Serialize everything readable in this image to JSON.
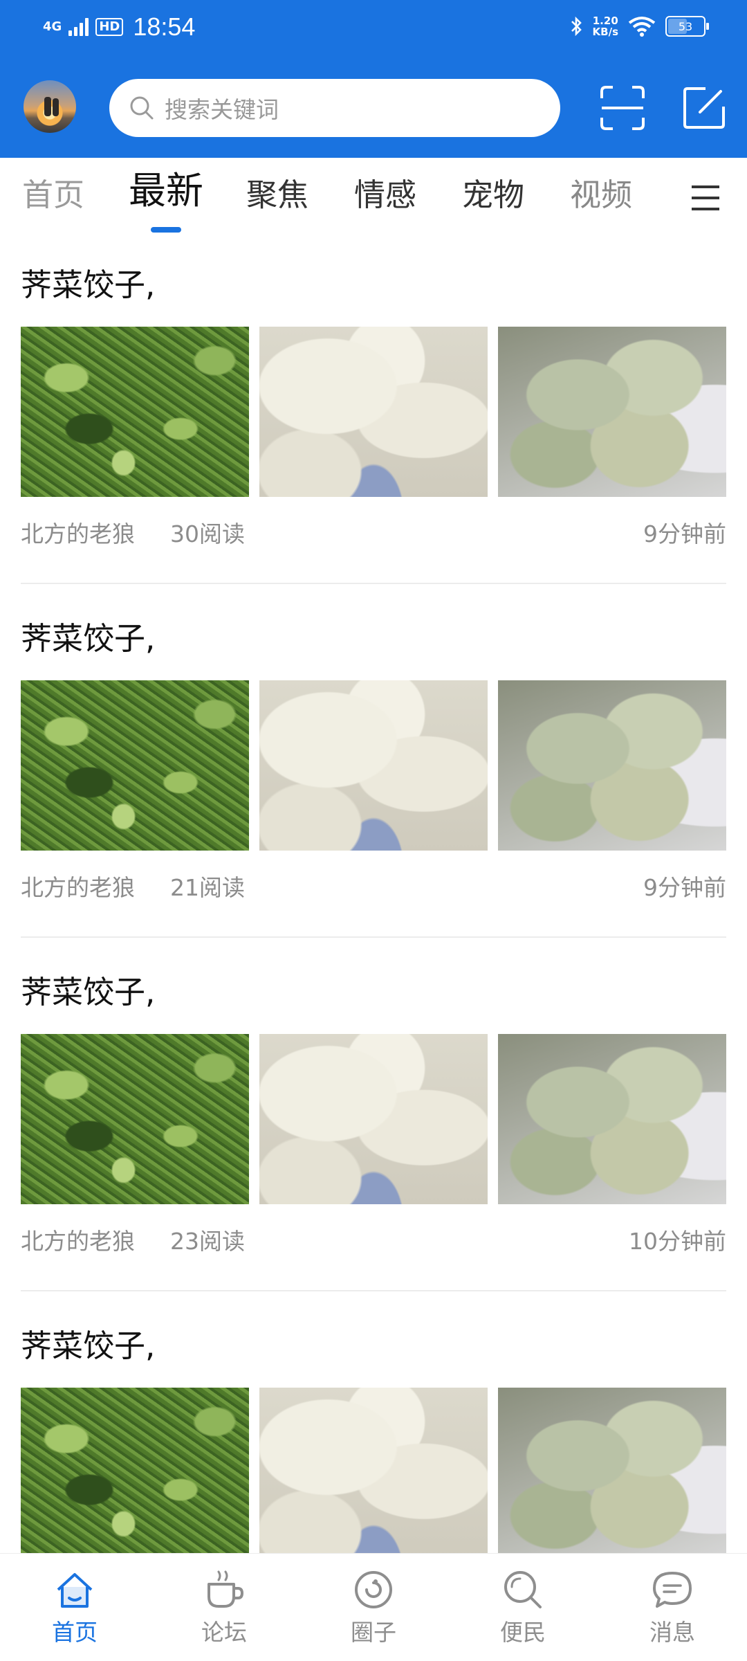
{
  "status_bar": {
    "network": "4G",
    "hd": "HD",
    "time": "18:54",
    "speed_value": "1.20",
    "speed_unit": "KB/s",
    "battery": "53"
  },
  "header": {
    "avatar_icon": "avatar-sunset",
    "search_placeholder": "搜索关键词",
    "scan_icon": "scan-icon",
    "edit_icon": "edit-icon"
  },
  "tabs": [
    {
      "label": "首页"
    },
    {
      "label": "最新",
      "active": true
    },
    {
      "label": "聚焦"
    },
    {
      "label": "情感"
    },
    {
      "label": "宠物"
    },
    {
      "label": "视频"
    }
  ],
  "feed": [
    {
      "title": "荠菜饺子,",
      "author": "北方的老狼",
      "reads": "30阅读",
      "time": "9分钟前"
    },
    {
      "title": "荠菜饺子,",
      "author": "北方的老狼",
      "reads": "21阅读",
      "time": "9分钟前"
    },
    {
      "title": "荠菜饺子,",
      "author": "北方的老狼",
      "reads": "23阅读",
      "time": "10分钟前"
    },
    {
      "title": "荠菜饺子,"
    }
  ],
  "bottom_nav": [
    {
      "label": "首页",
      "icon": "home-icon",
      "active": true
    },
    {
      "label": "论坛",
      "icon": "coffee-cup-icon"
    },
    {
      "label": "圈子",
      "icon": "circle-icon"
    },
    {
      "label": "便民",
      "icon": "search-icon"
    },
    {
      "label": "消息",
      "icon": "chat-bubble-icon"
    }
  ],
  "colors": {
    "brand_blue": "#1a73e0",
    "meta_gray": "#8c8c8c"
  }
}
